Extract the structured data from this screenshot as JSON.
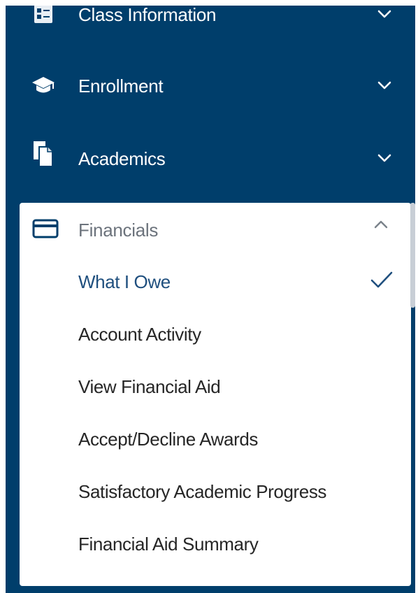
{
  "nav": {
    "items": [
      {
        "label": "Class Information",
        "icon": "class-info-icon"
      },
      {
        "label": "Enrollment",
        "icon": "graduation-cap-icon"
      },
      {
        "label": "Academics",
        "icon": "documents-icon"
      }
    ],
    "financials": {
      "label": "Financials",
      "icon": "credit-card-icon",
      "expanded": true,
      "items": [
        {
          "label": "What I Owe",
          "selected": true
        },
        {
          "label": "Account Activity",
          "selected": false
        },
        {
          "label": "View Financial Aid",
          "selected": false
        },
        {
          "label": "Accept/Decline Awards",
          "selected": false
        },
        {
          "label": "Satisfactory Academic Progress",
          "selected": false
        },
        {
          "label": "Financial Aid Summary",
          "selected": false
        }
      ]
    }
  },
  "colors": {
    "nav_background": "#003e6b",
    "active_text": "#1f4f7e",
    "muted_text": "#6c737c",
    "item_text": "#262626"
  }
}
